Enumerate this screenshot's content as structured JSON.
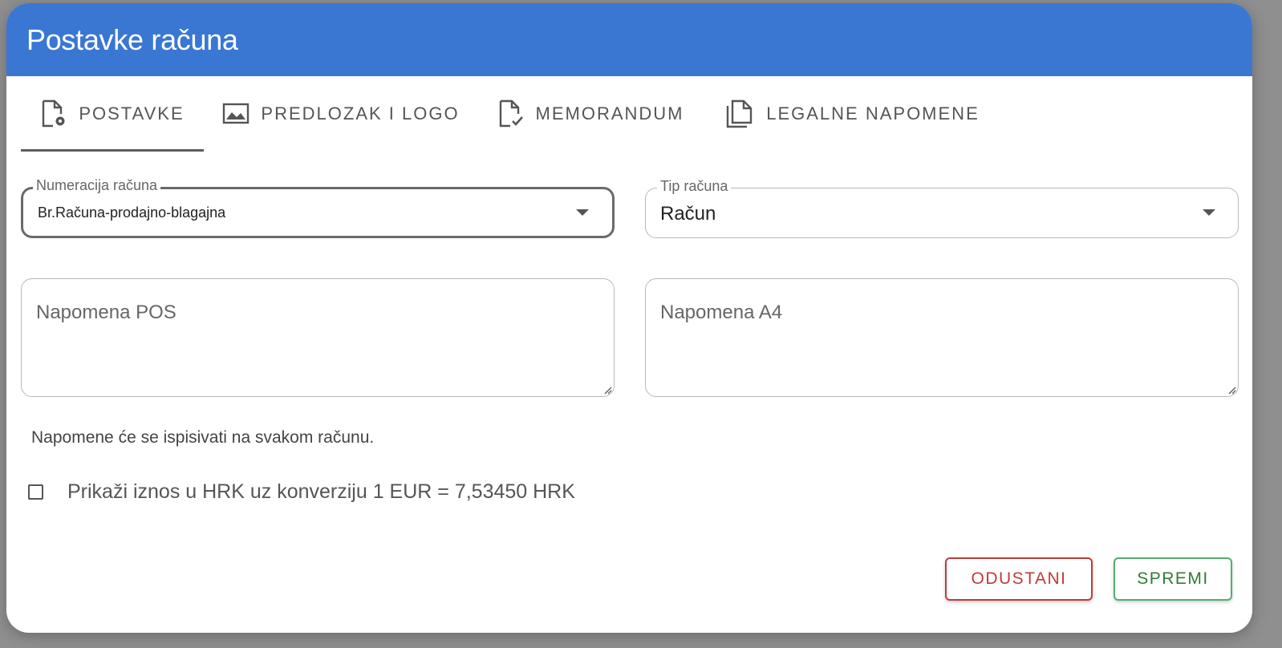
{
  "dialog": {
    "title": "Postavke računa"
  },
  "tabs": [
    {
      "label": "POSTAVKE",
      "icon": "file-settings-icon",
      "active": true
    },
    {
      "label": "PREDLOZAK I LOGO",
      "icon": "image-icon",
      "active": false
    },
    {
      "label": "MEMORANDUM",
      "icon": "file-check-icon",
      "active": false
    },
    {
      "label": "LEGALNE NAPOMENE",
      "icon": "copy-documents-icon",
      "active": false
    }
  ],
  "form": {
    "numeracija": {
      "label": "Numeracija računa",
      "value": "Br.Računa-prodajno-blagajna"
    },
    "tip": {
      "label": "Tip računa",
      "value": "Račun"
    },
    "napomena_pos": {
      "placeholder": "Napomena POS",
      "value": ""
    },
    "napomena_a4": {
      "placeholder": "Napomena A4",
      "value": ""
    },
    "note": "Napomene će se ispisivati na svakom računu.",
    "hrk_checkbox": {
      "label": "Prikaži iznos u HRK uz konverziju 1 EUR = 7,53450 HRK",
      "checked": false
    }
  },
  "actions": {
    "cancel_label": "ODUSTANI",
    "save_label": "SPREMI"
  },
  "colors": {
    "header": "#3a77d3",
    "cancel": "#c23a3a",
    "save": "#53ad6e"
  }
}
